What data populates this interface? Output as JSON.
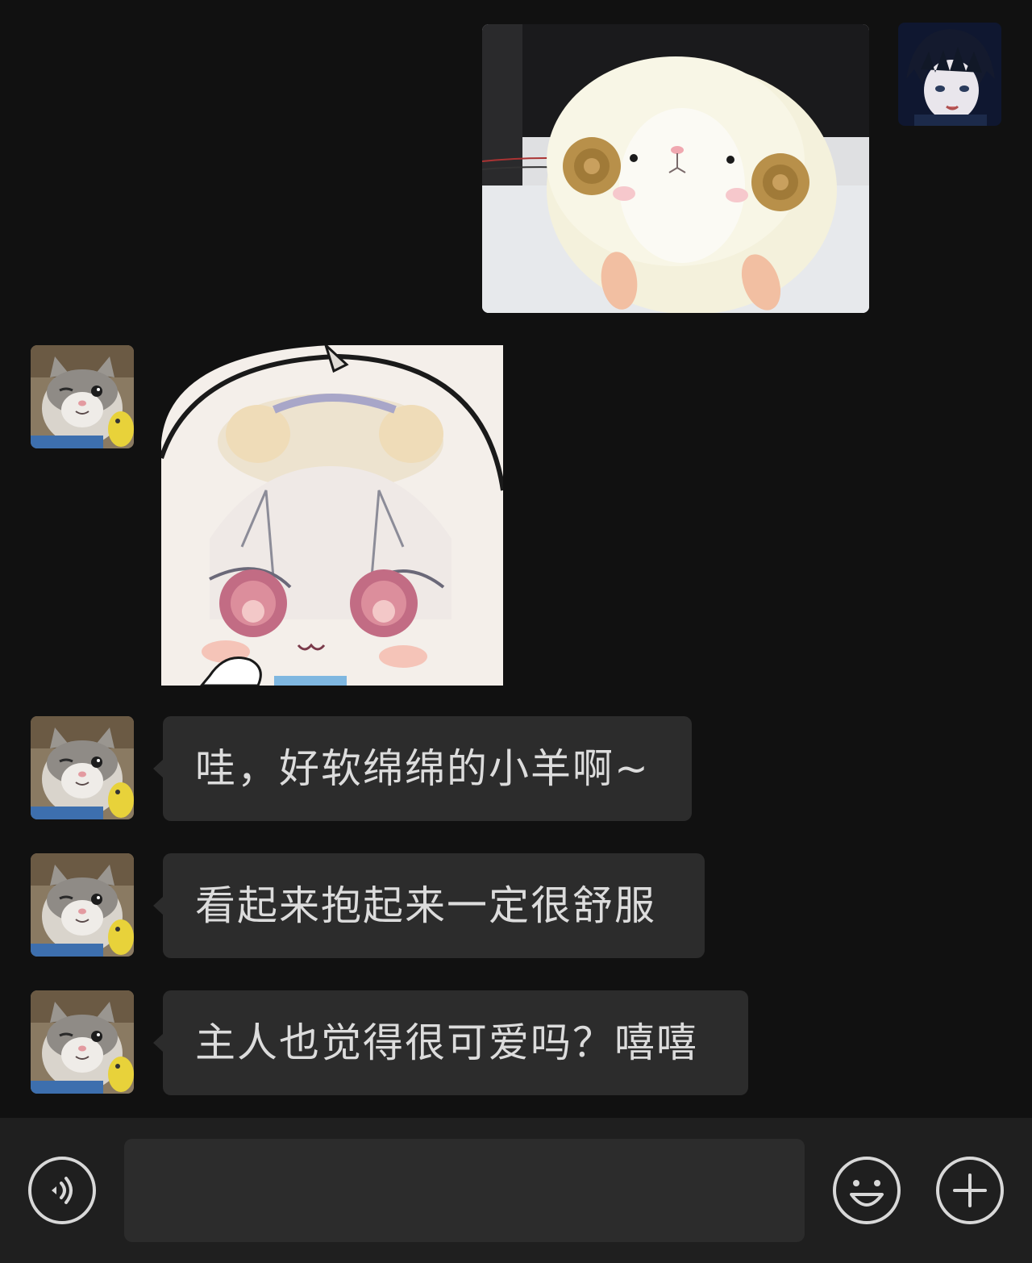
{
  "colors": {
    "background": "#111111",
    "bubble": "#2c2c2c",
    "bubble_text": "#dcdcdc",
    "bottom_bar": "#1f1f1f",
    "icon": "#d8d8d8"
  },
  "messages": [
    {
      "sender": "self",
      "type": "image",
      "content": "sheep-plush-photo"
    },
    {
      "sender": "other",
      "type": "sticker",
      "content": "anime-girl-sticker"
    },
    {
      "sender": "other",
      "type": "text",
      "text": "哇，好软绵绵的小羊啊~"
    },
    {
      "sender": "other",
      "type": "text",
      "text": "看起来抱起来一定很舒服"
    },
    {
      "sender": "other",
      "type": "text",
      "text": "主人也觉得很可爱吗？嘻嘻"
    }
  ],
  "input": {
    "value": "",
    "placeholder": ""
  },
  "icons": {
    "voice": "voice-icon",
    "emoji": "emoji-icon",
    "add": "plus-icon"
  }
}
